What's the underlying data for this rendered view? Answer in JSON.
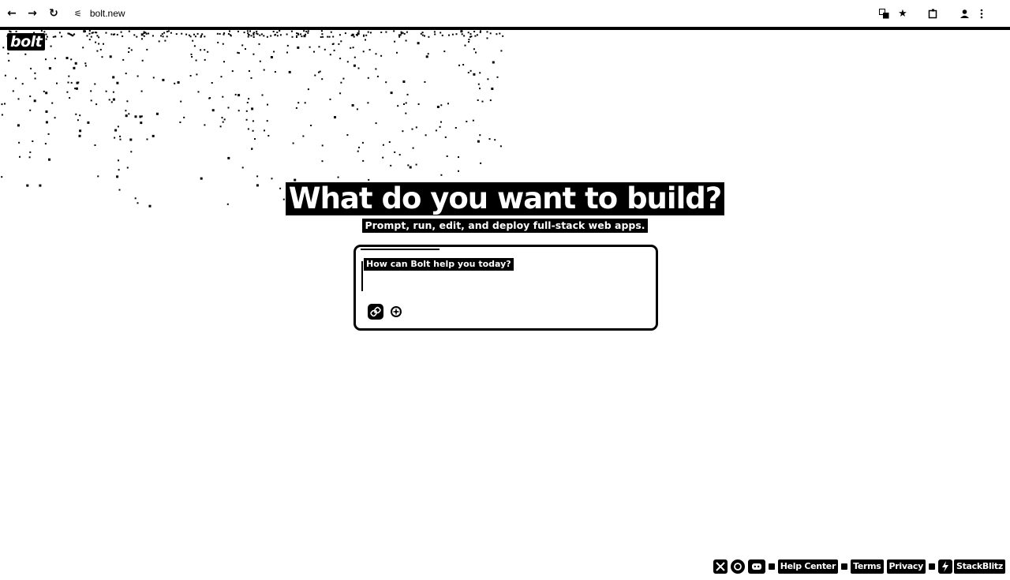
{
  "browser": {
    "url": "bolt.new",
    "icons": {
      "back": "arrow-left-icon",
      "forward": "arrow-right-icon",
      "reload": "reload-icon",
      "site_settings": "tune-icon",
      "translate": "translate-icon",
      "bookmark": "star-icon",
      "extensions": "puzzle-icon",
      "profile": "person-icon",
      "menu": "kebab-menu-icon"
    }
  },
  "logo": {
    "text": "bolt"
  },
  "hero": {
    "title": "What do you want to build?",
    "subtitle": "Prompt, run, edit, and deploy full-stack web apps."
  },
  "prompt": {
    "placeholder": "How can Bolt help you today?",
    "actions": [
      "attach-link-icon",
      "enhance-prompt-icon"
    ]
  },
  "footer": {
    "social_icons": [
      "x-icon",
      "github-icon",
      "discord-icon"
    ],
    "links": [
      "Help Center",
      "Terms",
      "Privacy"
    ],
    "brand": "StackBlitz"
  }
}
